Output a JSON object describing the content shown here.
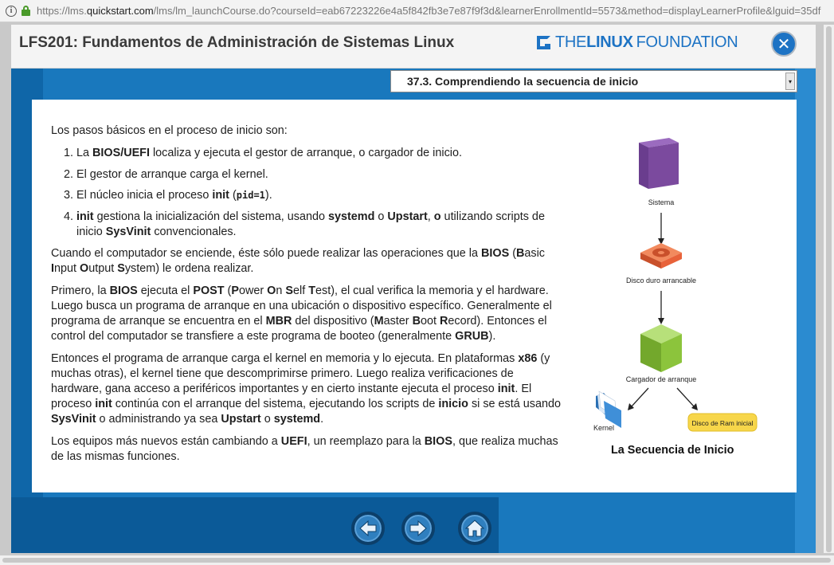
{
  "browser": {
    "url_prefix": "https://lms.",
    "url_domain": "quickstart.com",
    "url_path": "/lms/lm_launchCourse.do?courseId=eab67223226e4a5f842fb3e7e87f9f3d&learnerEnrollmentId=5573&method=displayLearnerProfile&lguid=35df"
  },
  "header": {
    "course_title": "LFS201: Fundamentos de Administración de Sistemas Linux",
    "brand_the": "THE",
    "brand_linux": "LINUX",
    "brand_foundation": "FOUNDATION",
    "close_symbol": "✕"
  },
  "section_select": {
    "selected": "37.3. Comprendiendo la secuencia de inicio",
    "arrow": "▾"
  },
  "content": {
    "intro": "Los pasos básicos en el proceso de inicio son:",
    "steps": [
      [
        "La ",
        "BIOS/UEFI",
        " localiza y ejecuta el gestor de arranque, o cargador de inicio."
      ],
      [
        "El gestor de arranque carga el kernel."
      ],
      [
        "El núcleo inicia el proceso ",
        "init",
        " (",
        "pid=1",
        ")."
      ],
      [
        "",
        "init",
        " gestiona la inicialización del sistema, usando ",
        "systemd",
        " o ",
        "Upstart",
        ", ",
        "o",
        " utilizando scripts de inicio ",
        "SysVinit",
        " convencionales."
      ]
    ],
    "p1": [
      "Cuando el computador se enciende, éste sólo puede realizar las operaciones que la ",
      "BIOS",
      " (",
      "B",
      "asic ",
      "I",
      "nput ",
      "O",
      "utput ",
      "S",
      "ystem) le ordena realizar."
    ],
    "p2": [
      "Primero, la ",
      "BIOS",
      " ejecuta el ",
      "POST",
      " (",
      "P",
      "ower ",
      "O",
      "n ",
      "S",
      "elf ",
      "T",
      "est), el cual verifica la memoria y el hardware. Luego busca un programa de arranque en una ubicación o dispositivo específico. Generalmente el programa de arranque se encuentra en el ",
      "MBR",
      " del dispositivo (",
      "M",
      "aster ",
      "B",
      "oot ",
      "R",
      "ecord). Entonces el control del computador se transfiere a este programa de booteo (generalmente ",
      "GRUB",
      ")."
    ],
    "p3": [
      "Entonces el programa de arranque carga el kernel en memoria y lo ejecuta. En plataformas ",
      "x86",
      " (y muchas otras), el kernel tiene que descomprimirse primero. Luego realiza verificaciones de hardware, gana acceso a periféricos importantes y en cierto instante ejecuta el proceso ",
      "init",
      ". El proceso ",
      "init",
      " continúa con el arranque del sistema, ejecutando los scripts de ",
      "inicio",
      " si se está usando ",
      "SysVinit",
      " o administrando ya sea ",
      "Upstart",
      " o ",
      "systemd",
      "."
    ],
    "p4": [
      "Los equipos más nuevos están cambiando a ",
      "UEFI",
      ", un reemplazo para la ",
      "BIOS",
      ", que realiza muchas de las mismas funciones."
    ]
  },
  "diagram": {
    "labels": {
      "sistema": "Sistema",
      "disco": "Disco duro arrancable",
      "cargador": "Cargador de arranque",
      "kernel": "Kernel",
      "ram": "Disco de Ram inicial"
    },
    "caption": "La Secuencia de Inicio",
    "colors": {
      "server": "#7b4a9e",
      "disk": "#e8623a",
      "cube": "#8cc43c",
      "folder": "#3f8fd8",
      "ram": "#f7d64a"
    }
  },
  "nav": {
    "back": "arrow-left-icon",
    "forward": "arrow-right-icon",
    "home": "home-icon"
  }
}
